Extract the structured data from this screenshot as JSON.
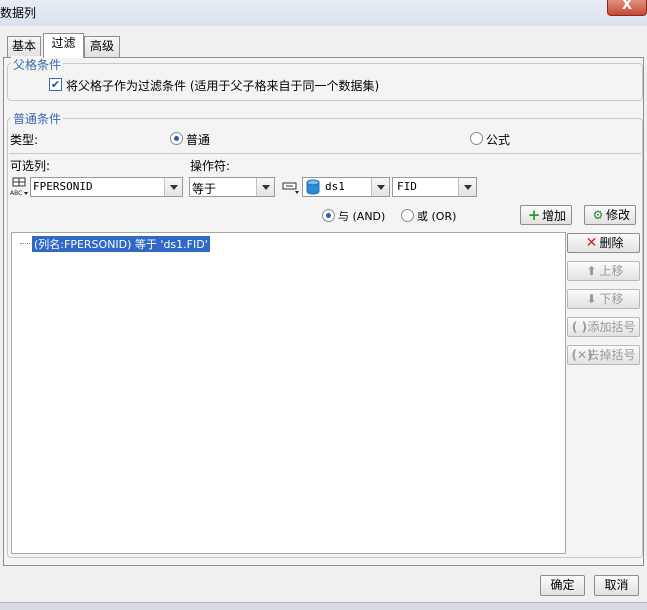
{
  "window": {
    "title": "数据列",
    "close_symbol": "X"
  },
  "tabs": [
    {
      "label": "基本"
    },
    {
      "label": "过滤"
    },
    {
      "label": "高级"
    }
  ],
  "parent_group": {
    "legend": "父格条件",
    "checkbox_label": "将父格子作为过滤条件 (适用于父子格来自于同一个数据集)",
    "checked": true
  },
  "normal_group": {
    "legend": "普通条件",
    "type_label": "类型:",
    "type_normal": "普通",
    "type_formula": "公式",
    "selected_type": "普通",
    "column_label": "可选列:",
    "operator_label": "操作符:",
    "column_value": "FPERSONID",
    "operator_value": "等于",
    "dataset_value": "ds1",
    "field_value": "FID",
    "and_label": "与 (AND)",
    "or_label": "或 (OR)",
    "logic_selected": "与 (AND)",
    "add_button": "增加",
    "modify_button": "修改"
  },
  "condition_list": [
    "(列名:FPERSONID) 等于 'ds1.FID'"
  ],
  "side_buttons": {
    "delete": "删除",
    "move_up": "上移",
    "move_down": "下移",
    "add_bracket": "添加括号",
    "remove_bracket": "去掉括号"
  },
  "footer": {
    "ok": "确定",
    "cancel": "取消"
  },
  "colors": {
    "accent": "#3168c6",
    "legend": "#3b6aa8",
    "close": "#c74a33"
  }
}
